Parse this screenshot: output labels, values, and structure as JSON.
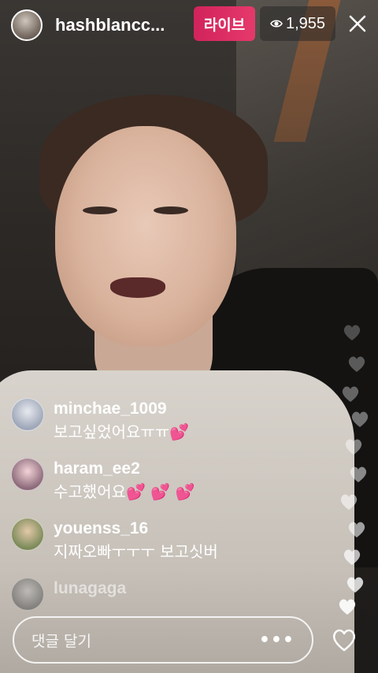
{
  "header": {
    "username": "hashblancc...",
    "live_label": "라이브",
    "viewer_count": "1,955"
  },
  "comments": [
    {
      "username": "minchae_1009",
      "text": "보고싶었어요ㅠㅠ",
      "emoji": "💕"
    },
    {
      "username": "haram_ee2",
      "text": "수고했어요",
      "emoji": "💕 💕 💕"
    },
    {
      "username": "youenss_16",
      "text": "지짜오빠ㅜㅜㅜ 보고싯버",
      "emoji": ""
    },
    {
      "username": "lunagaga",
      "text": "",
      "emoji": ""
    }
  ],
  "comment_input": {
    "placeholder": "댓글 달기",
    "more_label": "•••"
  },
  "colors": {
    "live_badge": "#e02f65",
    "heart": "#ff5fa8"
  },
  "icons": [
    "eye-icon",
    "close-icon",
    "heart-outline-icon"
  ]
}
